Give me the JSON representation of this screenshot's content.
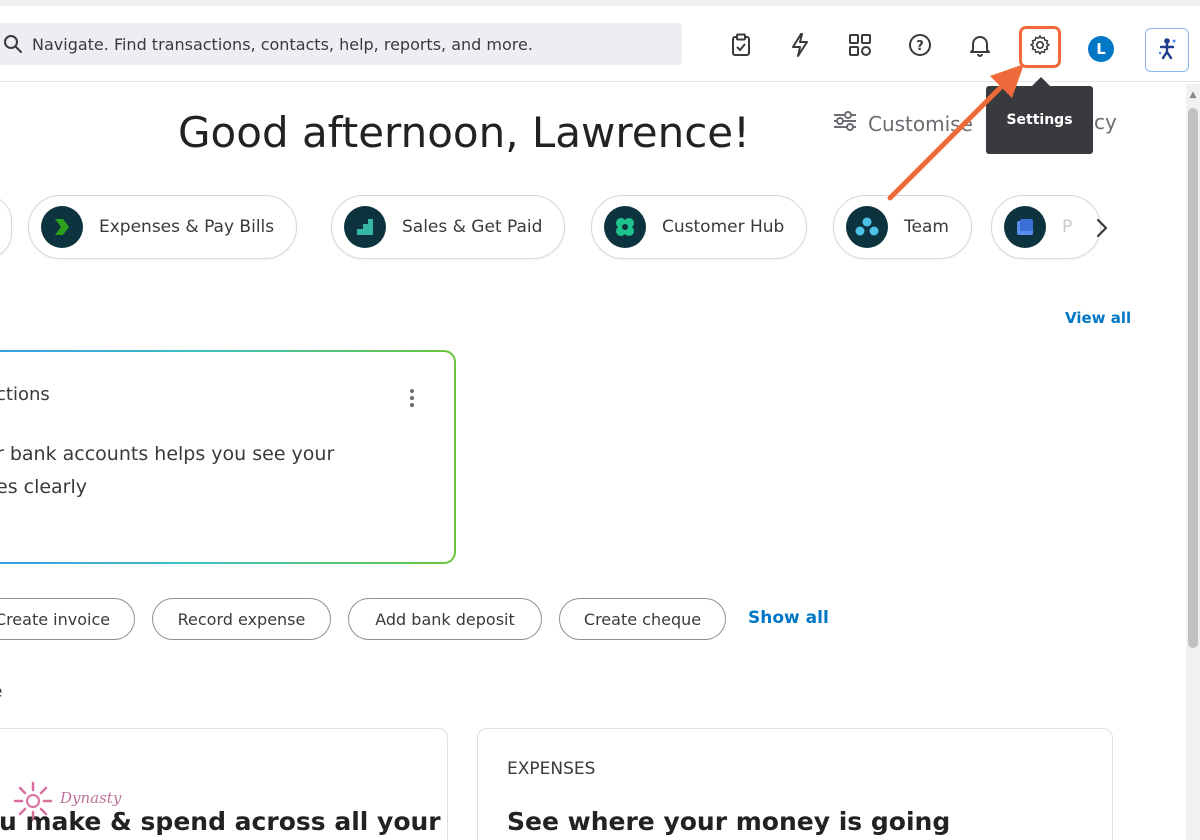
{
  "search": {
    "placeholder": "Navigate. Find transactions, contacts, help, reports, and more."
  },
  "topbar": {
    "icons": [
      "clipboard-check-icon",
      "lightning-icon",
      "apps-grid-icon",
      "help-icon",
      "bell-icon",
      "gear-icon"
    ],
    "avatar_letter": "L"
  },
  "tooltip": {
    "text": "Settings"
  },
  "greeting": "Good afternoon, Lawrence!",
  "header_links": {
    "customise": "Customise",
    "privacy": "cy"
  },
  "chips": [
    {
      "label": "Expenses & Pay Bills"
    },
    {
      "label": "Sales & Get Paid"
    },
    {
      "label": "Customer Hub"
    },
    {
      "label": "Team"
    },
    {
      "label": "P"
    }
  ],
  "view_all": "View all",
  "card": {
    "title": "ctions",
    "body_line1": "r bank accounts helps you see your",
    "body_line2": "es clearly"
  },
  "actions": {
    "pills": [
      "Create invoice",
      "Record expense",
      "Add bank deposit",
      "Create cheque"
    ],
    "show_all": "Show all"
  },
  "section_label": "e",
  "bottom_cards": {
    "left_heading": "u make & spend across all your",
    "right_eyebrow": "EXPENSES",
    "right_heading": "See where your money is going"
  },
  "watermark": {
    "text": "Dynasty"
  },
  "colors": {
    "accent_blue": "#0077c5",
    "annotation_orange": "#ef6a3a",
    "dark_teal": "#0d333f"
  }
}
